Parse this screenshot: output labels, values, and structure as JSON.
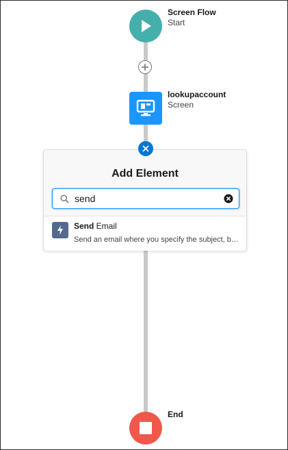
{
  "flow": {
    "start": {
      "title": "Screen Flow",
      "subtitle": "Start"
    },
    "screen": {
      "title": "lookupaccount",
      "subtitle": "Screen"
    },
    "end": {
      "title": "End"
    }
  },
  "add_element": {
    "title": "Add Element",
    "search": {
      "value": "send",
      "placeholder": ""
    },
    "results": [
      {
        "match": "Send",
        "rest": " Email",
        "description": "Send an email where you specify the subject, body, and recipients."
      }
    ]
  },
  "icons": {
    "start": "play-icon",
    "screen": "monitor-icon",
    "end": "stop-icon",
    "add": "plus-icon",
    "close": "close-icon",
    "search": "search-icon",
    "clear": "clear-icon",
    "result": "lightning-icon"
  },
  "colors": {
    "start": "#45b0ab",
    "screen": "#1b96ff",
    "end": "#f0584b",
    "connector": "#c9c9c9",
    "accent": "#0176d3",
    "action_icon": "#54698d"
  }
}
